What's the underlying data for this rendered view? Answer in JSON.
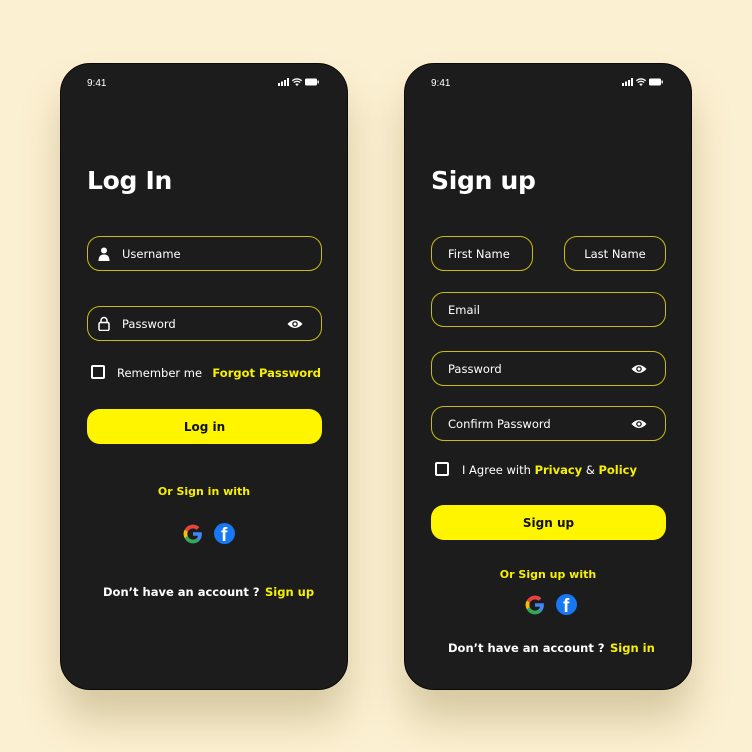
{
  "colors": {
    "background": "#fcf0d2",
    "phone": "#1c1c1c",
    "accent": "#fff500",
    "border": "#c9bb12"
  },
  "login": {
    "status": {
      "time": "9:41",
      "icons": [
        "signal-icon",
        "wifi-icon",
        "battery-icon"
      ]
    },
    "title": "Log In",
    "username": {
      "placeholder": "Username",
      "icon": "user-icon"
    },
    "password": {
      "placeholder": "Password",
      "icon": "lock-icon",
      "toggle_icon": "eye-icon"
    },
    "remember_label": "Remember me",
    "remember_checked": false,
    "forgot_label": "Forgot Password",
    "submit_label": "Log in",
    "alt_label": "Or Sign in with",
    "social": [
      "google-icon",
      "facebook-icon"
    ],
    "footer_text": "Don’t have an account ?",
    "footer_link": "Sign up"
  },
  "signup": {
    "status": {
      "time": "9:41",
      "icons": [
        "signal-icon",
        "wifi-icon",
        "battery-icon"
      ]
    },
    "title": "Sign up",
    "first_name": {
      "placeholder": "First Name"
    },
    "last_name": {
      "placeholder": "Last Name"
    },
    "email": {
      "placeholder": "Email"
    },
    "password": {
      "placeholder": "Password",
      "toggle_icon": "eye-icon"
    },
    "confirm_password": {
      "placeholder": "Confirm Password",
      "toggle_icon": "eye-icon"
    },
    "agree": {
      "prefix": "I Agree with",
      "privacy": "Privacy",
      "amp": "&",
      "policy": "Policy",
      "checked": false
    },
    "submit_label": "Sign up",
    "alt_label": "Or Sign up with",
    "social": [
      "google-icon",
      "facebook-icon"
    ],
    "footer_text": "Don’t have an account ?",
    "footer_link": "Sign in"
  }
}
